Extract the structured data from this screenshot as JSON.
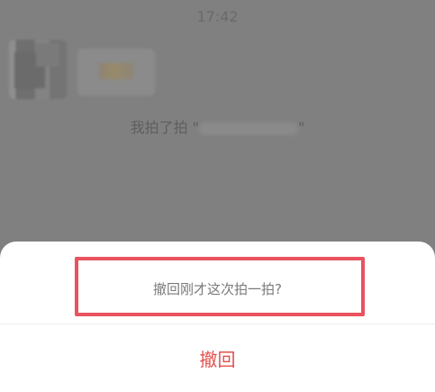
{
  "status_bar": {
    "time": "17:42"
  },
  "chat": {
    "pat_text_prefix": "我拍了拍 \"",
    "pat_text_suffix": "\""
  },
  "action_sheet": {
    "title": "撤回刚才这次拍一拍?",
    "revoke_label": "撤回"
  },
  "colors": {
    "overlay": "#7f7f7f",
    "sheet_background": "#ffffff",
    "revoke_text": "#e3504e",
    "highlight_box": "#e8535e"
  }
}
